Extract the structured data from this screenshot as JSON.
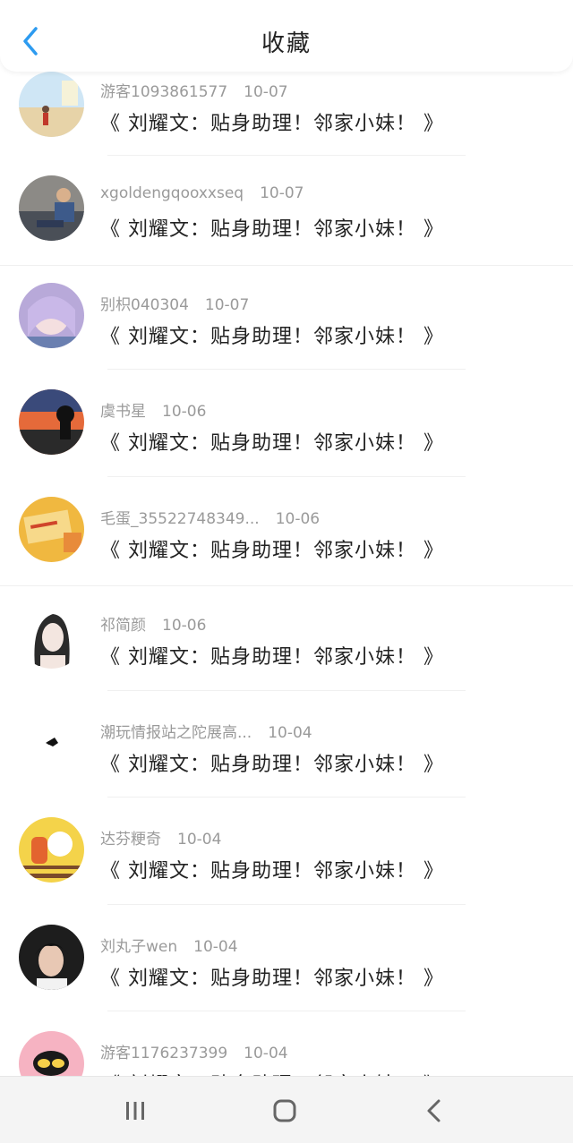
{
  "header": {
    "title": "收藏",
    "back_icon": "chevron-left-icon",
    "accent": "#2d9bf0"
  },
  "items": [
    {
      "user": "游客1093861577",
      "date": "10-07",
      "content": "《 刘耀文：贴身助理！邻家小妹！ 》",
      "avatar": "beach-photo-avatar"
    },
    {
      "user": "xgoldengqooxxseq",
      "date": "10-07",
      "content": "《 刘耀文：贴身助理！邻家小妹！ 》",
      "avatar": "man-sofa-avatar"
    },
    {
      "user": "别枳040304",
      "date": "10-07",
      "content": "《 刘耀文：贴身助理！邻家小妹！ 》",
      "avatar": "anime-girl-avatar"
    },
    {
      "user": "虞书星",
      "date": "10-06",
      "content": "《 刘耀文：贴身助理！邻家小妹！ 》",
      "avatar": "sunset-silhouette-avatar"
    },
    {
      "user": "毛蛋_35522748349...",
      "date": "10-06",
      "content": "《 刘耀文：贴身助理！邻家小妹！ 》",
      "avatar": "yellow-paper-avatar"
    },
    {
      "user": "祁简颜",
      "date": "10-06",
      "content": "《 刘耀文：贴身助理！邻家小妹！ 》",
      "avatar": "sketch-girl-avatar"
    },
    {
      "user": "潮玩情报站之陀展高...",
      "date": "10-04",
      "content": "《 刘耀文：贴身助理！邻家小妹！ 》",
      "avatar": "small-bird-avatar"
    },
    {
      "user": "达芬粳奇",
      "date": "10-04",
      "content": "《 刘耀文：贴身助理！邻家小妹！ 》",
      "avatar": "capricorn-cartoon-avatar"
    },
    {
      "user": "刘丸子wen",
      "date": "10-04",
      "content": "《 刘耀文：贴身助理！邻家小妹！ 》",
      "avatar": "boy-portrait-avatar"
    },
    {
      "user": "游客1176237399",
      "date": "10-04",
      "content": "《 刘耀文：贴身助理！邻家小妹！ 》",
      "avatar": "monkey-cartoon-avatar"
    }
  ],
  "navbar": {
    "recent": "recent-apps-icon",
    "home": "home-icon",
    "back": "back-icon"
  }
}
